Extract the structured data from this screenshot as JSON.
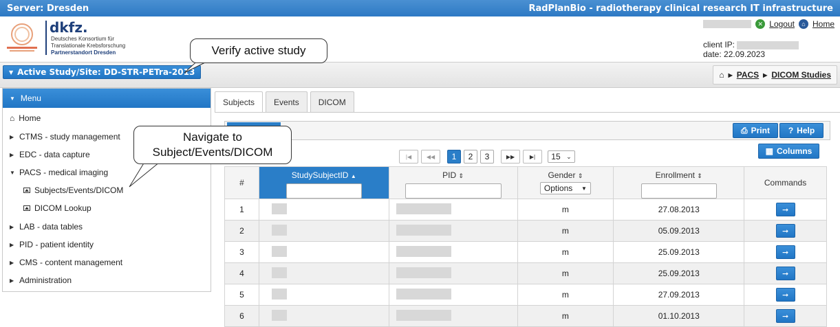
{
  "topbar": {
    "server": "Server: Dresden",
    "title": "RadPlanBio - radiotherapy clinical research IT infrastructure"
  },
  "header": {
    "logo": {
      "name": "dkfz.",
      "line1": "Deutsches Konsortium für",
      "line2": "Translationale Krebsforschung",
      "line3": "Partnerstandort Dresden"
    },
    "logout_label": "Logout",
    "home_label": "Home",
    "client_ip_label": "client IP:",
    "date_label": "date: 22.09.2023"
  },
  "study_button": "Active Study/Site: DD-STR-PETra-2013",
  "breadcrumb": {
    "items": [
      "PACS",
      "DICOM Studies"
    ]
  },
  "menu": {
    "title": "Menu",
    "items": [
      "Home",
      "CTMS - study management",
      "EDC - data capture",
      "PACS - medical imaging",
      "Subjects/Events/DICOM",
      "DICOM Lookup",
      "LAB - data tables",
      "PID - patient identity",
      "CMS - content management",
      "Administration"
    ]
  },
  "tabs": [
    "Subjects",
    "Events",
    "DICOM"
  ],
  "toolbar": {
    "print_label": "Print",
    "help_label": "Help",
    "columns_label": "Columns"
  },
  "pagination": {
    "pages": [
      "1",
      "2",
      "3"
    ],
    "current": "1",
    "page_size": "15"
  },
  "table": {
    "headers": {
      "num": "#",
      "study_subject_id": "StudySubjectID",
      "pid": "PID",
      "gender": "Gender",
      "enrollment": "Enrollment",
      "commands": "Commands"
    },
    "gender_filter": "Options",
    "rows": [
      {
        "num": "1",
        "gender": "m",
        "enrollment": "27.08.2013"
      },
      {
        "num": "2",
        "gender": "m",
        "enrollment": "05.09.2013"
      },
      {
        "num": "3",
        "gender": "m",
        "enrollment": "25.09.2013"
      },
      {
        "num": "4",
        "gender": "m",
        "enrollment": "25.09.2013"
      },
      {
        "num": "5",
        "gender": "m",
        "enrollment": "27.09.2013"
      },
      {
        "num": "6",
        "gender": "m",
        "enrollment": "01.10.2013"
      }
    ]
  },
  "callouts": {
    "verify": "Verify active study",
    "navigate_line1": "Navigate to",
    "navigate_line2": "Subject/Events/DICOM"
  },
  "colors": {
    "accent": "#2a7ec8",
    "topbar": "#3a87cf"
  }
}
